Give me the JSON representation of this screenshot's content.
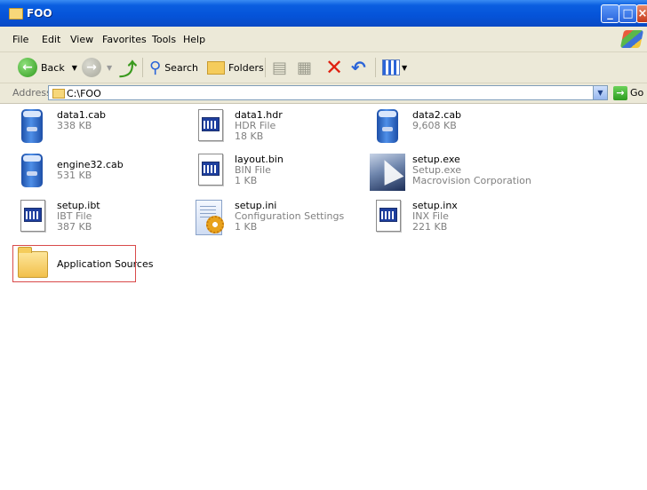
{
  "window": {
    "title": "FOO"
  },
  "menu": [
    "File",
    "Edit",
    "View",
    "Favorites",
    "Tools",
    "Help"
  ],
  "toolbar": {
    "back": "Back",
    "search": "Search",
    "folders": "Folders"
  },
  "address": {
    "label": "Address",
    "path": "C:\\FOO",
    "go": "Go"
  },
  "files": [
    {
      "name": "data1.cab",
      "desc": "",
      "size": "338 KB",
      "icon": "cab-icon"
    },
    {
      "name": "data1.hdr",
      "desc": "HDR File",
      "size": "18 KB",
      "icon": "document-icon"
    },
    {
      "name": "data2.cab",
      "desc": "",
      "size": "9,608 KB",
      "icon": "cab-icon"
    },
    {
      "name": "engine32.cab",
      "desc": "",
      "size": "531 KB",
      "icon": "cab-icon"
    },
    {
      "name": "layout.bin",
      "desc": "BIN File",
      "size": "1 KB",
      "icon": "document-icon"
    },
    {
      "name": "setup.exe",
      "desc": "Setup.exe",
      "size": "Macrovision Corporation",
      "icon": "setup-exe-icon"
    },
    {
      "name": "setup.ibt",
      "desc": "IBT File",
      "size": "387 KB",
      "icon": "document-icon"
    },
    {
      "name": "setup.ini",
      "desc": "Configuration Settings",
      "size": "1 KB",
      "icon": "config-settings-icon"
    },
    {
      "name": "setup.inx",
      "desc": "INX File",
      "size": "221 KB",
      "icon": "document-icon"
    },
    {
      "name": "Application Sources",
      "desc": "",
      "size": "",
      "icon": "folder-icon"
    }
  ]
}
